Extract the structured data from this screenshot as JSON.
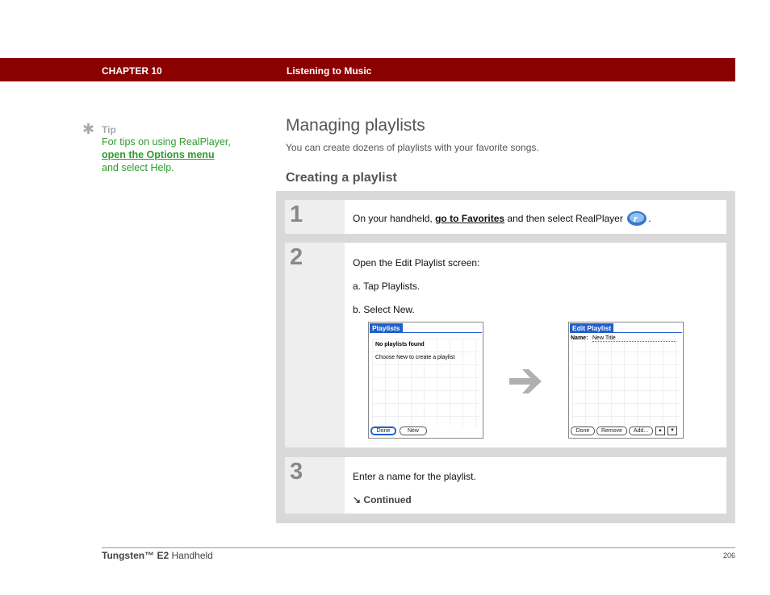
{
  "header": {
    "chapter": "CHAPTER 10",
    "section": "Listening to Music"
  },
  "tip": {
    "label": "Tip",
    "text_before": "For tips on using RealPlayer, ",
    "link": "open the Options menu",
    "text_after": " and select Help."
  },
  "page": {
    "title": "Managing playlists",
    "intro": "You can create dozens of playlists with your favorite songs.",
    "subheading": "Creating a playlist"
  },
  "steps": [
    {
      "number": "1",
      "text_before": "On your handheld, ",
      "link": "go to Favorites",
      "text_after": " and then select RealPlayer",
      "trailing": "."
    },
    {
      "number": "2",
      "text": "Open the Edit Playlist screen:",
      "sub_a": "a.  Tap Playlists.",
      "sub_b": "b.  Select New.",
      "screen1": {
        "title": "Playlists",
        "line1": "No playlists found",
        "line2": "Choose New to create a playlist",
        "btn_done": "Done",
        "btn_new": "New"
      },
      "screen2": {
        "title": "Edit Playlist",
        "name_label": "Name:",
        "name_value": "New Title",
        "btn_done": "Done",
        "btn_remove": "Remove",
        "btn_add": "Add...",
        "up_arrow": "▲",
        "down_arrow": "▼"
      }
    },
    {
      "number": "3",
      "text": "Enter a name for the playlist.",
      "continued": "Continued",
      "continued_icon": "↘"
    }
  ],
  "icons": {
    "tip_icon": "✱",
    "realplayer_icon": "realplayer-logo",
    "arrow_icon": "right-arrow"
  },
  "footer": {
    "product_bold": "Tungsten™ E2",
    "product_rest": " Handheld",
    "page_number": "206"
  },
  "colors": {
    "header_bg": "#8b0000",
    "tip_green": "#2e9b2e",
    "palm_blue": "#1f5fcf"
  }
}
